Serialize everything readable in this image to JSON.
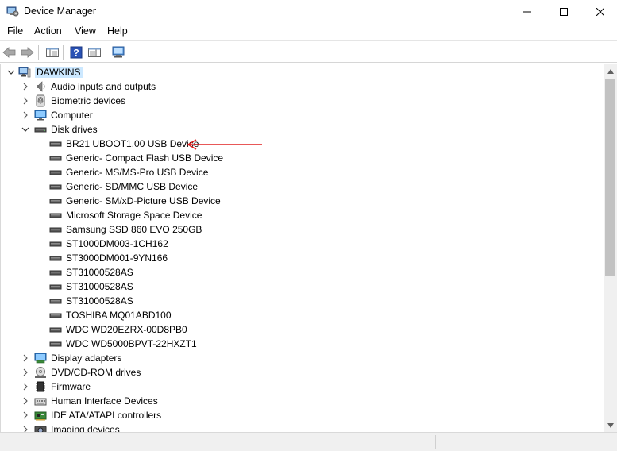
{
  "window": {
    "title": "Device Manager",
    "controls": {
      "minimize": "minimize-icon",
      "maximize": "maximize-icon",
      "close": "close-icon"
    }
  },
  "menu": [
    "File",
    "Action",
    "View",
    "Help"
  ],
  "toolbar": {
    "buttons": [
      "back-arrow-icon",
      "forward-arrow-icon",
      "show-hide-console-tree-icon",
      "help-icon",
      "properties-pane-icon",
      "scan-hardware-monitor-icon"
    ]
  },
  "tree": {
    "root": {
      "label": "DAWKINS",
      "expanded": true,
      "selected": true
    },
    "categories": [
      {
        "label": "Audio inputs and outputs",
        "icon": "speaker-icon",
        "expanded": false
      },
      {
        "label": "Biometric devices",
        "icon": "fingerprint-icon",
        "expanded": false
      },
      {
        "label": "Computer",
        "icon": "monitor-icon",
        "expanded": false
      },
      {
        "label": "Disk drives",
        "icon": "disk-drive-icon",
        "expanded": true,
        "children": [
          "BR21 UBOOT1.00 USB Device",
          "Generic- Compact Flash USB Device",
          "Generic- MS/MS-Pro USB Device",
          "Generic- SD/MMC USB Device",
          "Generic- SM/xD-Picture USB Device",
          "Microsoft Storage Space Device",
          "Samsung SSD 860 EVO 250GB",
          "ST1000DM003-1CH162",
          "ST3000DM001-9YN166",
          "ST31000528AS",
          "ST31000528AS",
          "ST31000528AS",
          "TOSHIBA MQ01ABD100",
          "WDC WD20EZRX-00D8PB0",
          "WDC WD5000BPVT-22HXZT1"
        ]
      },
      {
        "label": "Display adapters",
        "icon": "display-adapter-icon",
        "expanded": false
      },
      {
        "label": "DVD/CD-ROM drives",
        "icon": "optical-drive-icon",
        "expanded": false
      },
      {
        "label": "Firmware",
        "icon": "firmware-chip-icon",
        "expanded": false
      },
      {
        "label": "Human Interface Devices",
        "icon": "hid-icon",
        "expanded": false
      },
      {
        "label": "IDE ATA/ATAPI controllers",
        "icon": "ide-controller-icon",
        "expanded": false
      },
      {
        "label": "Imaging devices",
        "icon": "camera-icon",
        "expanded": false
      }
    ]
  },
  "colors": {
    "selection": "#cce8ff",
    "arrow_annotation": "#e02020",
    "scroll_thumb": "#c2c2c2"
  }
}
